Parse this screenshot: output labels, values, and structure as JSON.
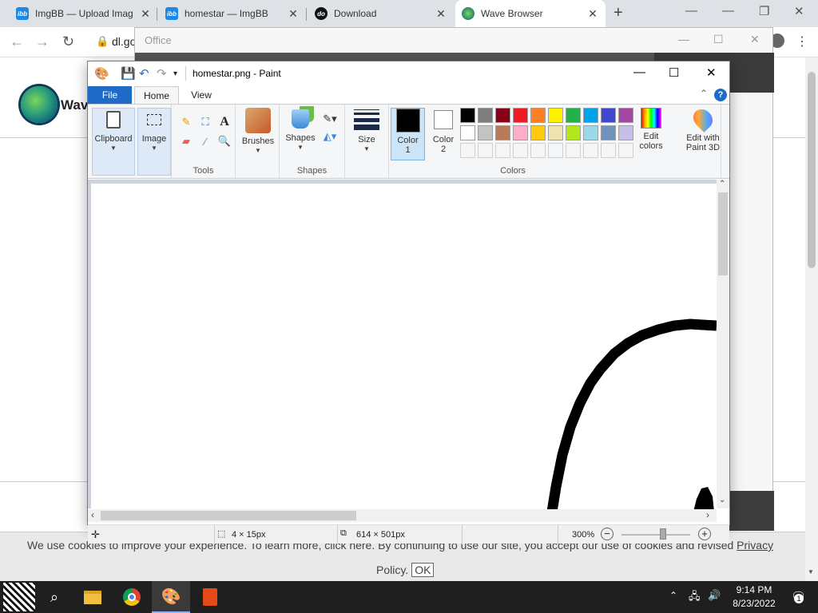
{
  "browser": {
    "tabs": [
      {
        "title": "ImgBB — Upload Imag",
        "icon_text": "ibb",
        "icon_color": "#1e88e5"
      },
      {
        "title": "homestar — ImgBB",
        "icon_text": "ibb",
        "icon_color": "#1e88e5"
      },
      {
        "title": "Download",
        "icon_text": "do",
        "icon_color": "#111111"
      },
      {
        "title": "Wave Browser",
        "icon_text": "",
        "icon_color": "#2a9b7b"
      }
    ],
    "new_tab": "+",
    "url": "dl.go"
  },
  "page": {
    "brand": "Wave",
    "cookie_text": "We use cookies to improve your experience. To learn more, click here. By continuing to use our site, you accept our use of cookies and revised",
    "cookie_link": "Privacy",
    "cookie_text2": "Policy.",
    "ok_label": "OK"
  },
  "office": {
    "title": "Office"
  },
  "paint": {
    "title": "homestar.png - Paint",
    "menu": {
      "file": "File",
      "home": "Home",
      "view": "View"
    },
    "ribbon": {
      "clipboard": "Clipboard",
      "image": "Image",
      "tools_label": "Tools",
      "brushes": "Brushes",
      "shapes": "Shapes",
      "shapes_group": "Shapes",
      "size": "Size",
      "color1": "Color\n1",
      "color1_a": "Color",
      "color1_b": "1",
      "color2_a": "Color",
      "color2_b": "2",
      "colors_group": "Colors",
      "edit_colors_a": "Edit",
      "edit_colors_b": "colors",
      "paint3d_a": "Edit with",
      "paint3d_b": "Paint 3D"
    },
    "palette_row1": [
      "#000000",
      "#7f7f7f",
      "#880015",
      "#ed1c24",
      "#ff7f27",
      "#fff200",
      "#22b14c",
      "#00a2e8",
      "#3f48cc",
      "#a349a4"
    ],
    "palette_row2": [
      "#ffffff",
      "#c3c3c3",
      "#b97a57",
      "#ffaec9",
      "#ffc90e",
      "#efe4b0",
      "#b5e61d",
      "#99d9ea",
      "#7092be",
      "#c8bfe7"
    ],
    "color1_value": "#000000",
    "color2_value": "#ffffff",
    "status": {
      "selection": "4 × 15px",
      "image_size": "614 × 501px",
      "zoom": "300%"
    }
  },
  "taskbar": {
    "time": "9:14 PM",
    "date": "8/23/2022",
    "notif_count": "1"
  }
}
